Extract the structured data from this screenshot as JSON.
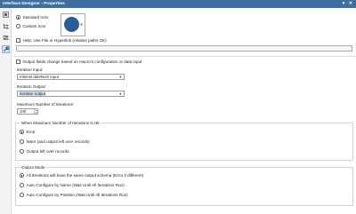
{
  "window": {
    "title": "Interface Designer - Properties"
  },
  "toolstrip": {
    "tools": [
      "select-tool",
      "tree-tool",
      "toggle-tool",
      "properties-tool"
    ]
  },
  "icon": {
    "standard_label": "Standard Icon",
    "custom_label": "Custom Icon",
    "color": "#2b5c9a"
  },
  "help": {
    "label": "Help: Use File or Hyperlink (relative paths OK)",
    "value": ""
  },
  "output_fields": {
    "label": "Output fields change based on macro's configuration or data input"
  },
  "iteration_input": {
    "label": "Iteration Input:",
    "value": "mhimst dateNum input"
  },
  "iteration_output": {
    "label": "Iteration Output:",
    "value": "Iterative output"
  },
  "max_iterations": {
    "label": "Maximum Number of Iterations:",
    "value": "100"
  },
  "when_max": {
    "title": "When Maximum Number of Iterations is Hit",
    "options": [
      "Error",
      "Warn (and output left over records)",
      "Output left over records"
    ],
    "selected": "Error"
  },
  "output_mode": {
    "title": "Output Mode",
    "options": [
      "All Iterations will have the same output schema (Error if different)",
      "Auto Configure by Name (Wait Until All Iterations Run)",
      "Auto Configure by Position (Wait Until All Iterations Run)"
    ],
    "selected": "All Iterations will have the same output schema (Error if different)"
  },
  "colors": {
    "titlebar": "#3f6f9f",
    "selection": "#cfe3f7",
    "icon": "#2b5c9a"
  }
}
